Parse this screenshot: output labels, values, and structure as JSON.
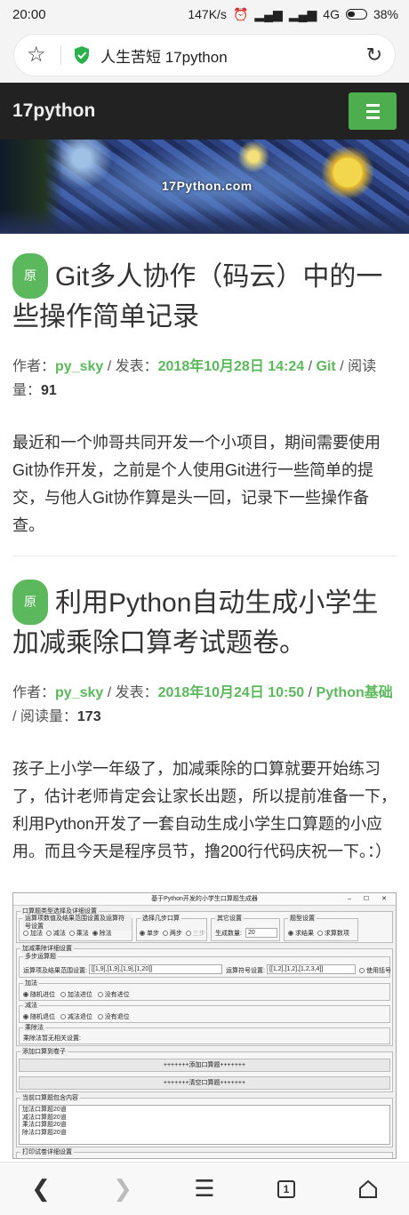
{
  "statusbar": {
    "time": "20:00",
    "speed": "147K/s",
    "network": "4G",
    "battery": "38%"
  },
  "browser": {
    "title": "人生苦短 17python"
  },
  "site": {
    "brand": "17python",
    "banner_logo": "17Python.com"
  },
  "posts": [
    {
      "badge": "原",
      "title": "Git多人协作（码云）中的一些操作简单记录",
      "meta": {
        "author_label": "作者：",
        "author": "py_sky",
        "sep1": " / 发表：",
        "date": "2018年10月28日 14:24",
        "sep2": " / ",
        "category": "Git",
        "sep3": " / 阅读量：",
        "views": "91"
      },
      "excerpt": "最近和一个帅哥共同开发一个小项目，期间需要使用Git协作开发，之前是个人使用Git进行一些简单的提交，与他人Git协作算是头一回，记录下一些操作备查。"
    },
    {
      "badge": "原",
      "title": "利用Python自动生成小学生加减乘除口算考试题卷。",
      "meta": {
        "author_label": "作者：",
        "author": "py_sky",
        "sep1": " / 发表：",
        "date": "2018年10月24日 10:50",
        "sep2": " / ",
        "category": "Python基础",
        "sep3": " / 阅读量：",
        "views": "173"
      },
      "excerpt": "孩子上小学一年级了，加减乘除的口算就要开始练习了，估计老师肯定会让家长出题，所以提前准备一下，利用Python开发了一套自动生成小学生口算题的小应用。而且今天是程序员节，撸200行代码庆祝一下。：）"
    }
  ],
  "screenshot": {
    "window_title": "基于Python开发的小学生口算题生成器",
    "g1_legend": "口算题类型选择及详细设置",
    "g1a_label": "运算项数值及结果范围设置及运算符号设置",
    "ops": [
      "加法",
      "减法",
      "乘法",
      "除法"
    ],
    "g1b_label": "选择几步口算",
    "steps": [
      "单步",
      "两步",
      "三步"
    ],
    "g1c_label": "其它设置",
    "gen_count_label": "生成数量:",
    "gen_count_value": "20",
    "g1d_label": "题型设置",
    "types": [
      "求结果",
      "求算数项"
    ],
    "g2_legend": "加减乘除详细设置",
    "multi_label": "多步运算题",
    "range_label": "运算项及结果范围设置:",
    "range_value": "[[1,9],[1,9],[1,9],[1,20]]",
    "opset_label": "运算符号设置:",
    "opset_value": "[[1,2],[1,2],[1,2,3,4]]",
    "bracket_label": "使用括号",
    "add_label": "加法",
    "add_opts": [
      "随机进位",
      "加法进位",
      "没有进位"
    ],
    "sub_label": "减法",
    "sub_opts": [
      "随机退位",
      "减法退位",
      "没有退位"
    ],
    "muldiv_label": "乘除法",
    "muldiv_text": "乘除法暂无相关设置:",
    "g3_legend": "添加口算到卷子",
    "add_btn": "+++++++添加口算题+++++++",
    "clear_btn": "+++++++清空口算题+++++++",
    "g4_legend": "当前口算题包含内容",
    "content_lines": [
      "加法口算题20道",
      "减法口算题20道",
      "乘法口算题20道",
      "除法口算题20道"
    ],
    "g5_legend": "打印试卷详细设置"
  }
}
